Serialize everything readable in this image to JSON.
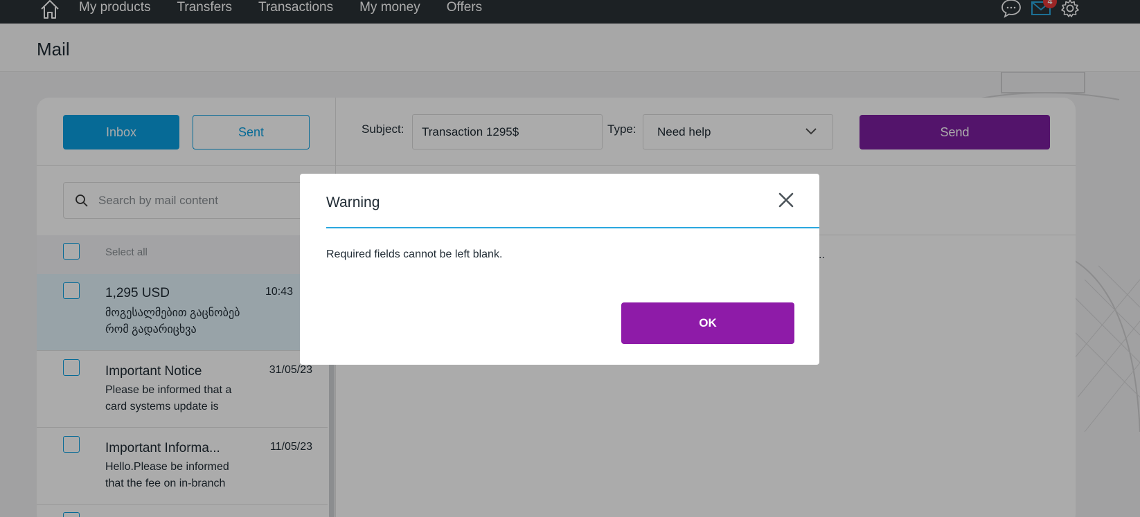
{
  "nav": {
    "items": [
      "My products",
      "Transfers",
      "Transactions",
      "My money",
      "Offers"
    ],
    "mail_badge": "4"
  },
  "header": {
    "title": "Mail"
  },
  "mailbox": {
    "inbox_label": "Inbox",
    "sent_label": "Sent",
    "search_placeholder": "Search by mail content",
    "select_all_label": "Select all",
    "items": [
      {
        "subject": "1,295 USD",
        "preview": "მოგესალმებით გაცნობებ რომ გადარიცხვა",
        "date": "10:43",
        "selected": true
      },
      {
        "subject": "Important Notice",
        "preview": "Please be informed that a card systems update is",
        "date": "31/05/23",
        "selected": false
      },
      {
        "subject": "Important Informa...",
        "preview": "Hello.Please be informed that the fee on in-branch",
        "date": "11/05/23",
        "selected": false
      }
    ]
  },
  "compose": {
    "subject_label": "Subject:",
    "subject_value": "Transaction 1295$",
    "type_label": "Type:",
    "type_value": "Need help",
    "send_label": "Send",
    "body_partial": ".."
  },
  "dialog": {
    "title": "Warning",
    "message": "Required fields cannot be left blank.",
    "ok_label": "OK"
  },
  "colors": {
    "primary_blue": "#0a9fe0",
    "primary_purple": "#8e1ba8",
    "topbar": "#2b3237",
    "badge_red": "#e63a3a"
  }
}
